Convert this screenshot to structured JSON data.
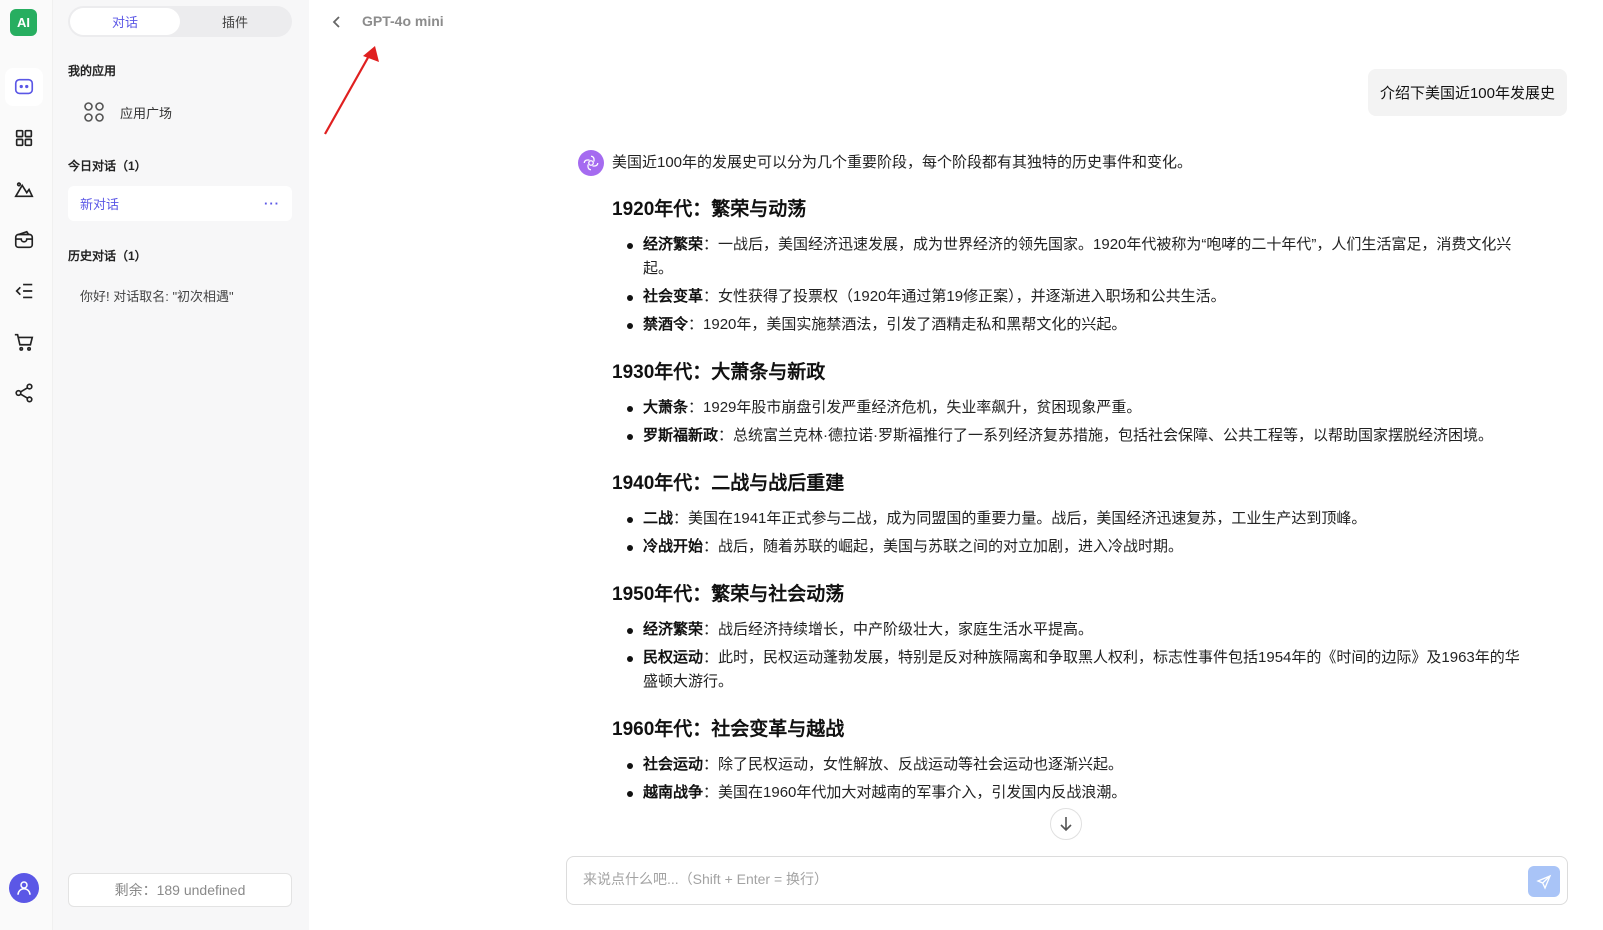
{
  "app": {
    "logo_text": "AI",
    "accent": "#5b57e6"
  },
  "rail": {
    "items": [
      {
        "name": "chat-icon",
        "active": true
      },
      {
        "name": "apps-grid-icon",
        "active": false
      },
      {
        "name": "image-mountain-icon",
        "active": false
      },
      {
        "name": "wallet-icon",
        "active": false
      },
      {
        "name": "list-icon",
        "active": false
      },
      {
        "name": "cart-icon",
        "active": false
      },
      {
        "name": "share-icon",
        "active": false
      }
    ]
  },
  "sidebar": {
    "tabs": [
      {
        "label": "对话",
        "active": true
      },
      {
        "label": "插件",
        "active": false
      }
    ],
    "my_apps_title": "我的应用",
    "app_square_label": "应用广场",
    "today_title": "今日对话（1）",
    "today_item": "新对话",
    "more_label": "···",
    "history_title": "历史对话（1）",
    "history_item": "你好! 对话取名: \"初次相遇\"",
    "remaining": "剩余：189 undefined"
  },
  "main": {
    "model_name": "GPT-4o mini",
    "user_message": "介绍下美国近100年发展史",
    "intro": "美国近100年的发展史可以分为几个重要阶段，每个阶段都有其独特的历史事件和变化。",
    "sections": [
      {
        "heading": "1920年代：繁荣与动荡",
        "items": [
          {
            "term": "经济繁荣",
            "text": "：一战后，美国经济迅速发展，成为世界经济的领先国家。1920年代被称为“咆哮的二十年代”，人们生活富足，消费文化兴起。"
          },
          {
            "term": "社会变革",
            "text": "：女性获得了投票权（1920年通过第19修正案），并逐渐进入职场和公共生活。"
          },
          {
            "term": "禁酒令",
            "text": "：1920年，美国实施禁酒法，引发了酒精走私和黑帮文化的兴起。"
          }
        ]
      },
      {
        "heading": "1930年代：大萧条与新政",
        "items": [
          {
            "term": "大萧条",
            "text": "：1929年股市崩盘引发严重经济危机，失业率飙升，贫困现象严重。"
          },
          {
            "term": "罗斯福新政",
            "text": "：总统富兰克林·德拉诺·罗斯福推行了一系列经济复苏措施，包括社会保障、公共工程等，以帮助国家摆脱经济困境。"
          }
        ]
      },
      {
        "heading": "1940年代：二战与战后重建",
        "items": [
          {
            "term": "二战",
            "text": "：美国在1941年正式参与二战，成为同盟国的重要力量。战后，美国经济迅速复苏，工业生产达到顶峰。"
          },
          {
            "term": "冷战开始",
            "text": "：战后，随着苏联的崛起，美国与苏联之间的对立加剧，进入冷战时期。"
          }
        ]
      },
      {
        "heading": "1950年代：繁荣与社会动荡",
        "items": [
          {
            "term": "经济繁荣",
            "text": "：战后经济持续增长，中产阶级壮大，家庭生活水平提高。"
          },
          {
            "term": "民权运动",
            "text": "：此时，民权运动蓬勃发展，特别是反对种族隔离和争取黑人权利，标志性事件包括1954年的《时间的边际》及1963年的华盛顿大游行。"
          }
        ]
      },
      {
        "heading": "1960年代：社会变革与越战",
        "items": [
          {
            "term": "社会运动",
            "text": "：除了民权运动，女性解放、反战运动等社会运动也逐渐兴起。"
          },
          {
            "term": "越南战争",
            "text": "：美国在1960年代加大对越南的军事介入，引发国内反战浪潮。"
          }
        ]
      }
    ],
    "input_placeholder": "来说点什么吧...（Shift + Enter = 换行）"
  }
}
